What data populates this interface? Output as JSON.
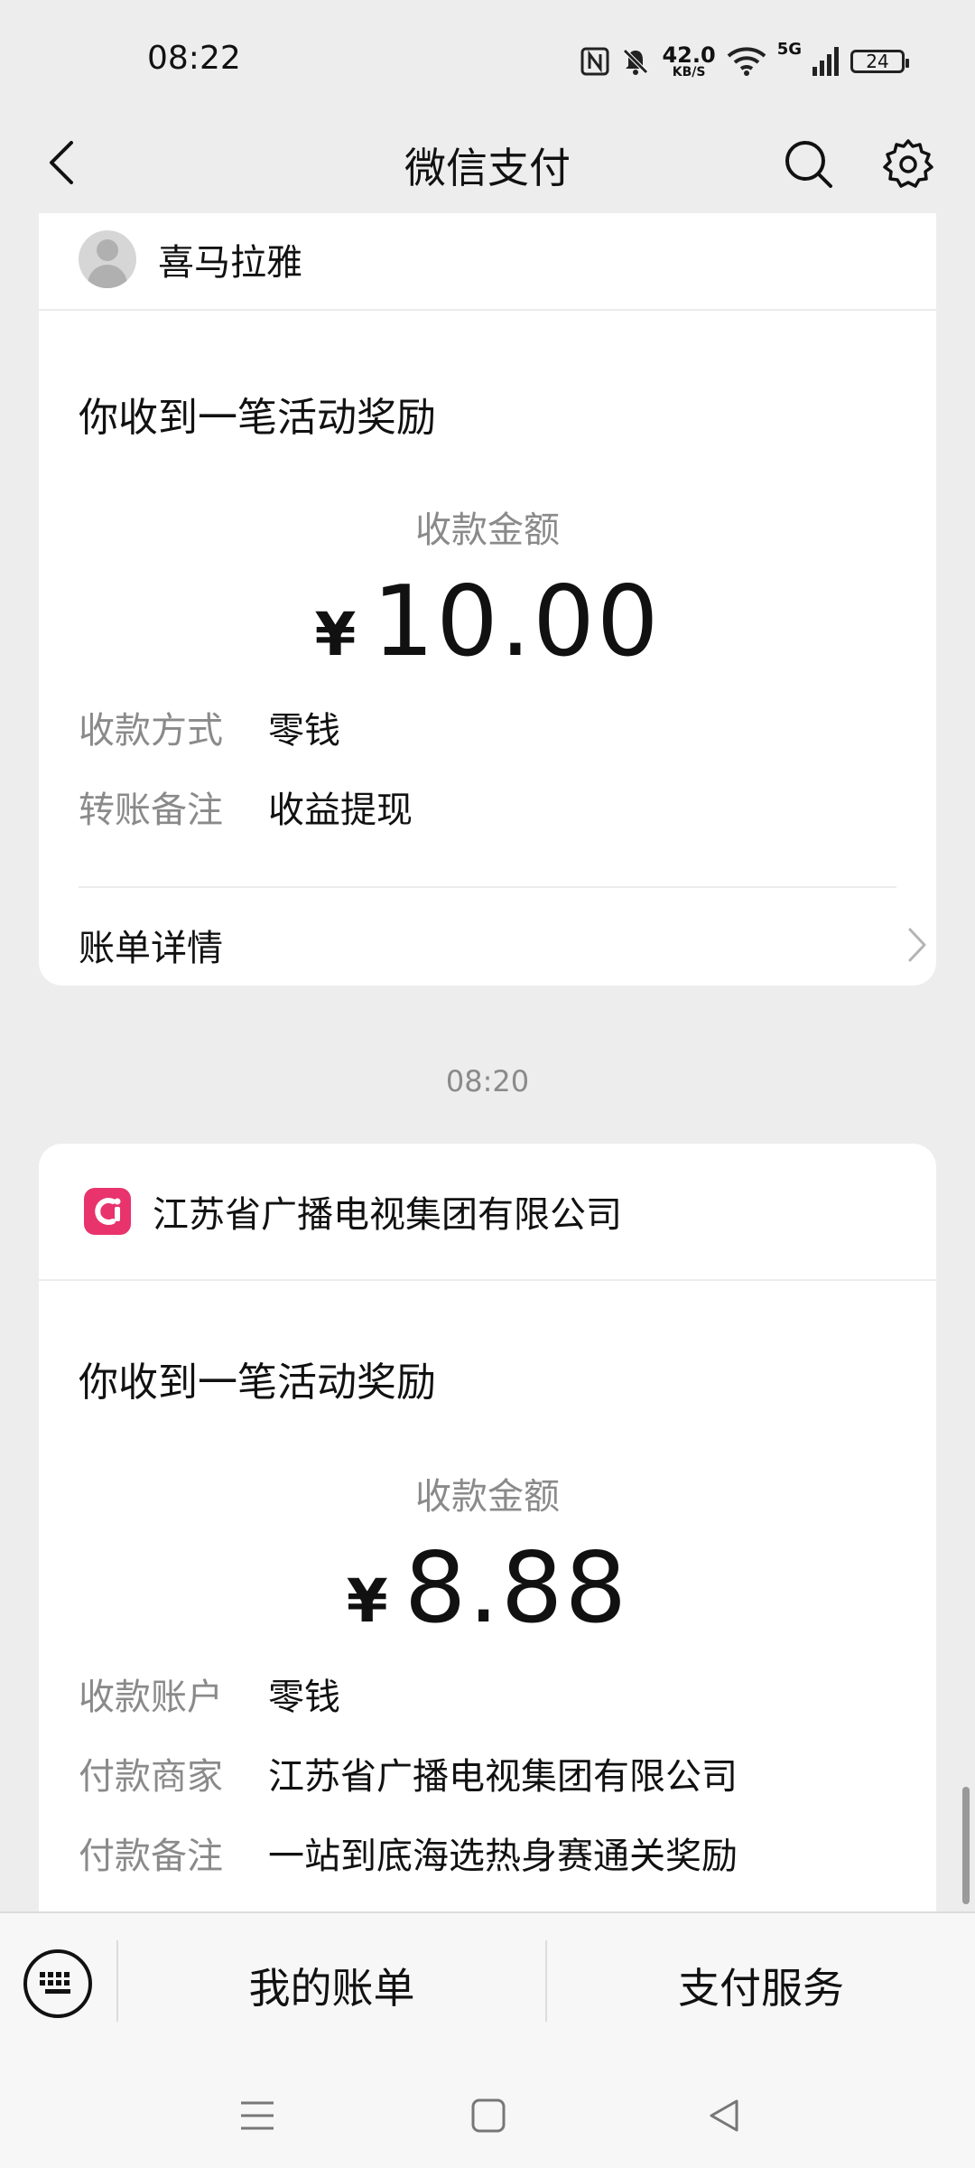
{
  "status_bar": {
    "time": "08:22",
    "speed_value": "42.0",
    "speed_unit": "KB/S",
    "network": "5G",
    "battery": "24"
  },
  "header": {
    "title": "微信支付",
    "back_icon": "chevron-left-icon",
    "search_icon": "search-icon",
    "settings_icon": "gear-icon"
  },
  "messages": [
    {
      "merchant": "喜马拉雅",
      "headline": "你收到一笔活动奖励",
      "amount_label": "收款金额",
      "currency": "¥",
      "amount": "10.00",
      "fields": [
        {
          "key": "收款方式",
          "value": "零钱"
        },
        {
          "key": "转账备注",
          "value": "收益提现"
        }
      ],
      "detail_label": "账单详情"
    },
    {
      "timestamp": "08:20",
      "merchant": "江苏省广播电视集团有限公司",
      "headline": "你收到一笔活动奖励",
      "amount_label": "收款金额",
      "currency": "¥",
      "amount": "8.88",
      "fields": [
        {
          "key": "收款账户",
          "value": "零钱"
        },
        {
          "key": "付款商家",
          "value": "江苏省广播电视集团有限公司"
        },
        {
          "key": "付款备注",
          "value": "一站到底海选热身赛通关奖励"
        }
      ]
    }
  ],
  "bottom_menu": {
    "keyboard_icon": "keyboard-icon",
    "items": [
      "我的账单",
      "支付服务"
    ]
  },
  "colors": {
    "background": "#ededed",
    "card": "#ffffff",
    "muted_text": "#8a8a8a",
    "logo_pink": "#e8336d"
  }
}
